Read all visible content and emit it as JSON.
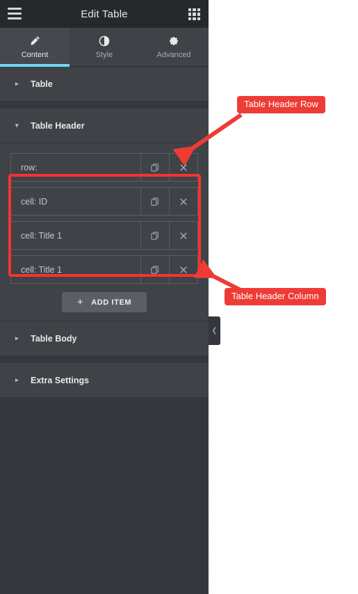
{
  "header": {
    "title": "Edit Table",
    "menu_icon": "hamburger-icon",
    "apps_icon": "grid-apps-icon"
  },
  "tabs": [
    {
      "label": "Content",
      "icon": "pencil-icon",
      "active": true
    },
    {
      "label": "Style",
      "icon": "contrast-icon",
      "active": false
    },
    {
      "label": "Advanced",
      "icon": "gear-icon",
      "active": false
    }
  ],
  "sections": [
    {
      "label": "Table",
      "expanded": false,
      "caret": "▸"
    },
    {
      "label": "Table Header",
      "expanded": true,
      "caret": "▾"
    },
    {
      "label": "Table Body",
      "expanded": false,
      "caret": "▸"
    },
    {
      "label": "Extra Settings",
      "expanded": false,
      "caret": "▸"
    }
  ],
  "repeater": {
    "items": [
      {
        "title": "row:",
        "duplicate_icon": "duplicate-icon",
        "remove_icon": "close-icon"
      },
      {
        "title": "cell: ID",
        "duplicate_icon": "duplicate-icon",
        "remove_icon": "close-icon"
      },
      {
        "title": "cell: Title 1",
        "duplicate_icon": "duplicate-icon",
        "remove_icon": "close-icon"
      },
      {
        "title": "cell: Title 1",
        "duplicate_icon": "duplicate-icon",
        "remove_icon": "close-icon"
      }
    ],
    "add_button": {
      "label": "ADD ITEM",
      "plus": "+"
    }
  },
  "collapse_handle": {
    "icon": "chevron-left-icon",
    "glyph": "❮"
  },
  "annotations": [
    {
      "text": "Table Header Row",
      "color": "#ef3b36"
    },
    {
      "text": "Table Header Column",
      "color": "#ef3b36"
    }
  ],
  "colors": {
    "panel_bg": "#34373d",
    "section_bg": "#3f4247",
    "header_bg": "#26292c",
    "accent": "#71d7f7",
    "annotation_red": "#ef3b36",
    "highlight_red": "#f5332f",
    "button_gray": "#5b5e65"
  }
}
